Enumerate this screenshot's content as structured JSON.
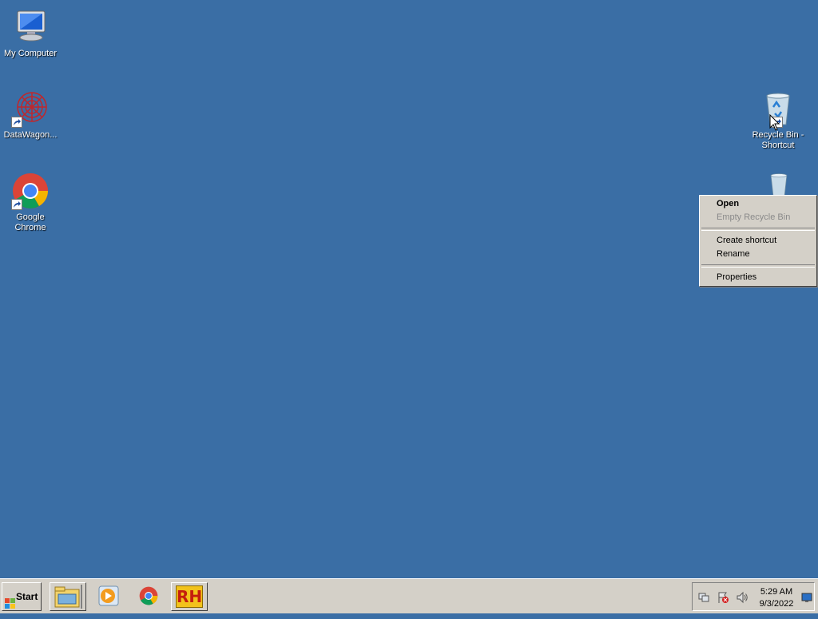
{
  "desktop": {
    "icons": [
      {
        "label": "My Computer",
        "icon": "my-computer-icon"
      },
      {
        "label": "DataWagon...",
        "icon": "datawagon-icon"
      },
      {
        "label": "Google Chrome",
        "icon": "chrome-icon"
      },
      {
        "label": "Recycle Bin - Shortcut",
        "icon": "recycle-bin-icon"
      }
    ],
    "background_color": "#3a6ea5"
  },
  "context_menu": {
    "items": [
      {
        "label": "Open",
        "bold": true
      },
      {
        "label": "Empty Recycle Bin",
        "disabled": true
      },
      {
        "label": "Create shortcut"
      },
      {
        "label": "Rename"
      },
      {
        "label": "Properties"
      }
    ]
  },
  "taskbar": {
    "start_label": "Start",
    "pinned": [
      {
        "name": "file-explorer-icon"
      },
      {
        "name": "media-player-icon"
      },
      {
        "name": "chrome-icon"
      },
      {
        "name": "rh-app-icon",
        "text": "RH"
      }
    ],
    "clock": {
      "time": "5:29 AM",
      "date": "9/3/2022"
    }
  }
}
